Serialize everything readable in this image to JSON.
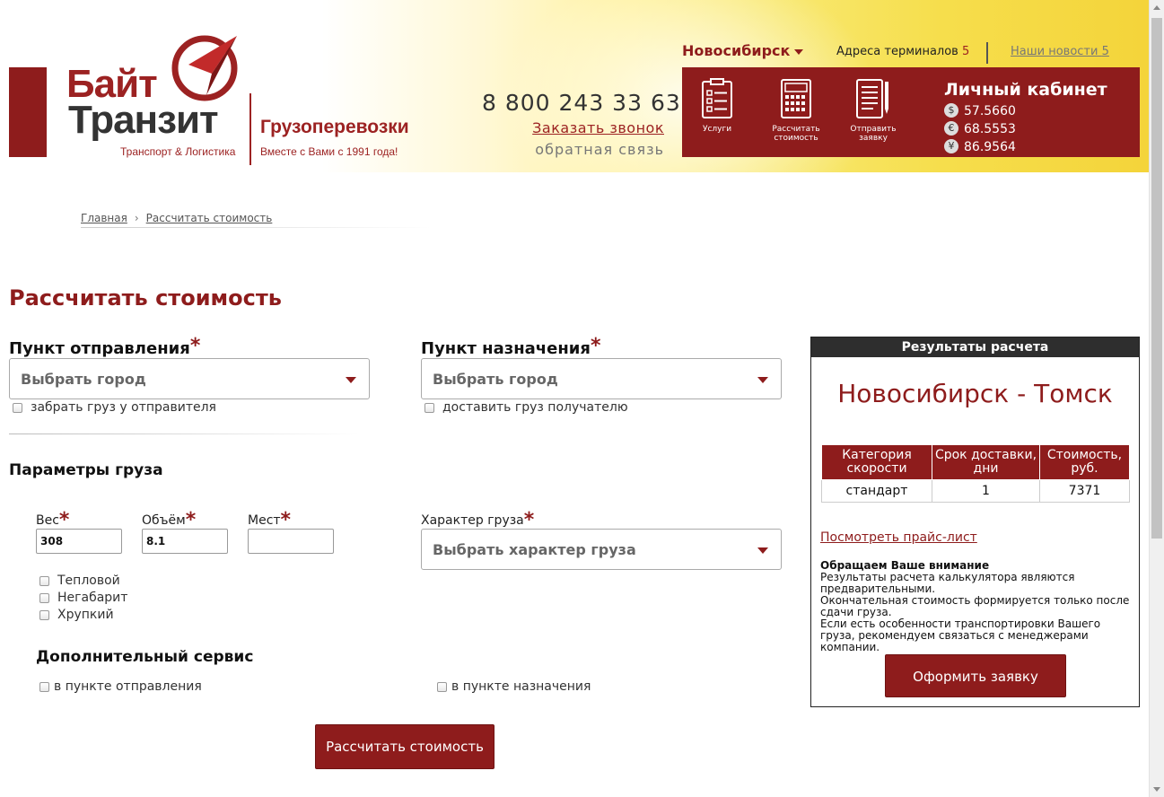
{
  "header": {
    "logo": {
      "word1": "Байт",
      "word2": "Транзит",
      "tagline": "Транспорт & Логистика",
      "subtitle": "Грузоперевозки",
      "subtitle2": "Вместе с Вами с 1991 года!"
    },
    "phone": "8 800 243 33 63",
    "call_link": "Заказать звонок",
    "feedback": "обратная связь",
    "city": "Новосибирск",
    "terminals_label": "Адреса терминалов",
    "terminals_count": "5",
    "news_label": "Наши новости",
    "news_count": "5",
    "nav": [
      {
        "label": "Услуги",
        "icon": "services-checklist-icon"
      },
      {
        "label": "Рассчитать стоимость",
        "icon": "calculator-icon"
      },
      {
        "label": "Отправить заявку",
        "icon": "send-request-icon"
      }
    ],
    "cabinet_title": "Личный кабинет",
    "rates": [
      {
        "symbol": "$",
        "value": "57.5660"
      },
      {
        "symbol": "€",
        "value": "68.5553"
      },
      {
        "symbol": "¥",
        "value": "86.9564"
      }
    ]
  },
  "breadcrumb": {
    "home": "Главная",
    "separator": "›",
    "current": "Рассчитать стоимость"
  },
  "page_title": "Рассчитать стоимость",
  "form": {
    "origin_label": "Пункт отправления",
    "origin_placeholder": "Выбрать город",
    "origin_pickup": "забрать груз у отправителя",
    "destination_label": "Пункт назначения",
    "destination_placeholder": "Выбрать город",
    "destination_delivery": "доставить груз получателю",
    "required_mark": "*",
    "cargo_params_title": "Параметры груза",
    "weight_label": "Вес",
    "weight_value": "308",
    "volume_label": "Объём",
    "volume_value": "8.1",
    "places_label": "Мест",
    "places_value": "",
    "cargo_type_label": "Характер груза",
    "cargo_type_placeholder": "Выбрать характер груза",
    "options": [
      "Тепловой",
      "Негабарит",
      "Хрупкий"
    ],
    "extra_service_title": "Дополнительный сервис",
    "extra_origin": "в пункте отправления",
    "extra_destination": "в пункте назначения",
    "submit": "Рассчитать стоимость"
  },
  "result": {
    "header": "Результаты расчета",
    "route": "Новосибирск - Томск",
    "columns": [
      "Категория скорости",
      "Срок доставки, дни",
      "Стоимость, руб."
    ],
    "rows": [
      [
        "стандарт",
        "1",
        "7371"
      ]
    ],
    "price_list_link": "Посмотреть прайс-лист",
    "notice_title": "Обращаем Ваше внимание",
    "notice_lines": [
      "Результаты расчета калькулятора являются предварительными.",
      "Окончательная стоимость формируется только после сдачи груза.",
      "Если есть особенности транспортировки Вашего груза, рекомендуем связаться с менеджерами компании."
    ],
    "order_button": "Оформить заявку"
  },
  "colors": {
    "brand": "#8e1c1c",
    "header_yellow": "#f4d43a"
  }
}
